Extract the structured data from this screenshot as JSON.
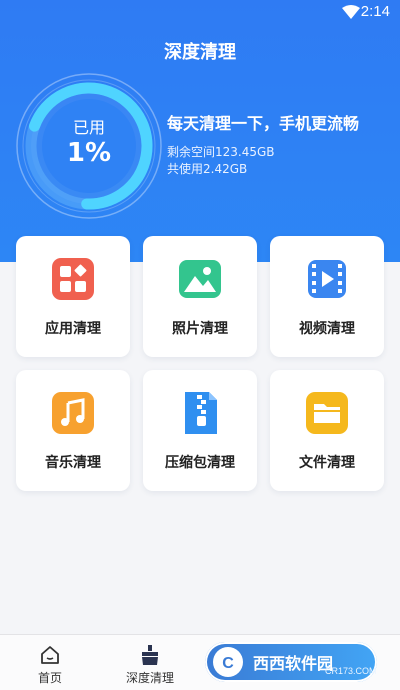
{
  "status_bar": {
    "time": "2:14",
    "wifi_icon": "wifi-icon"
  },
  "header": {
    "title": "深度清理",
    "gauge": {
      "label": "已用",
      "value_text": "1%",
      "used_fraction": 0.01
    },
    "slogan": "每天清理一下，手机更流畅",
    "remaining": "剩余空间123.45GB",
    "used": "共使用2.42GB"
  },
  "tools": [
    {
      "label": "应用清理",
      "icon": "apps-icon",
      "color": "#f0604f"
    },
    {
      "label": "照片清理",
      "icon": "photo-icon",
      "color": "#33c58e"
    },
    {
      "label": "视频清理",
      "icon": "video-icon",
      "color": "#3a86f0"
    },
    {
      "label": "音乐清理",
      "icon": "music-icon",
      "color": "#f7a12f"
    },
    {
      "label": "压缩包清理",
      "icon": "zip-icon",
      "color": "#2f8ff0"
    },
    {
      "label": "文件清理",
      "icon": "folder-icon",
      "color": "#f5b81d"
    }
  ],
  "tabbar": {
    "home": {
      "label": "首页",
      "icon": "home-icon"
    },
    "deep_clean": {
      "label": "深度清理",
      "icon": "broom-icon"
    }
  },
  "watermark": {
    "text": "西西软件园",
    "sub": "CR173.COM"
  }
}
